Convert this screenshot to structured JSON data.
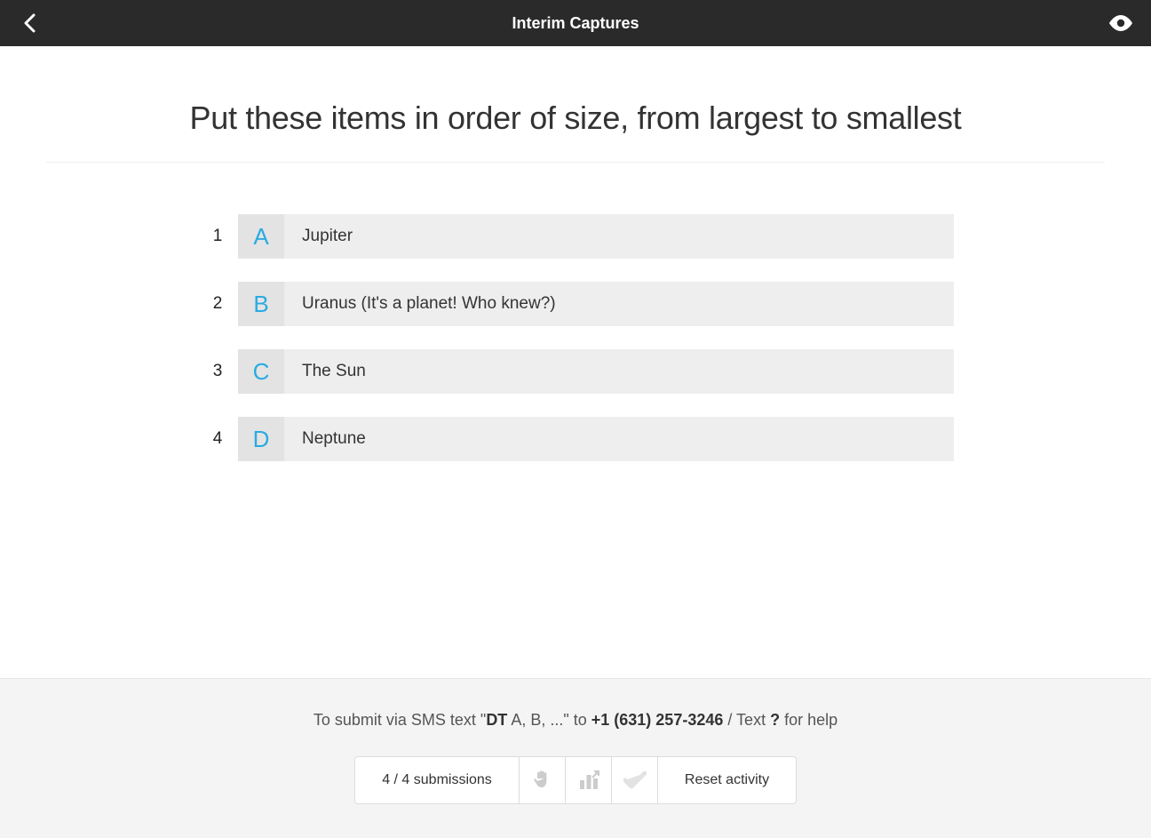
{
  "header": {
    "title": "Interim Captures"
  },
  "prompt": "Put these items in order of size, from largest to smallest",
  "options": [
    {
      "ord": "1",
      "letter": "A",
      "text": "Jupiter"
    },
    {
      "ord": "2",
      "letter": "B",
      "text": "Uranus (It's a planet! Who knew?)"
    },
    {
      "ord": "3",
      "letter": "C",
      "text": "The Sun"
    },
    {
      "ord": "4",
      "letter": "D",
      "text": "Neptune"
    }
  ],
  "footer": {
    "sms_pre": "To submit via SMS text \"",
    "sms_code": "DT",
    "sms_mid1": " A, B, ...\" to ",
    "sms_phone": "+1 (631) 257-3246",
    "sms_mid2": " / Text ",
    "sms_q": "?",
    "sms_end": " for help",
    "status": "4 / 4 submissions",
    "reset": "Reset activity"
  }
}
